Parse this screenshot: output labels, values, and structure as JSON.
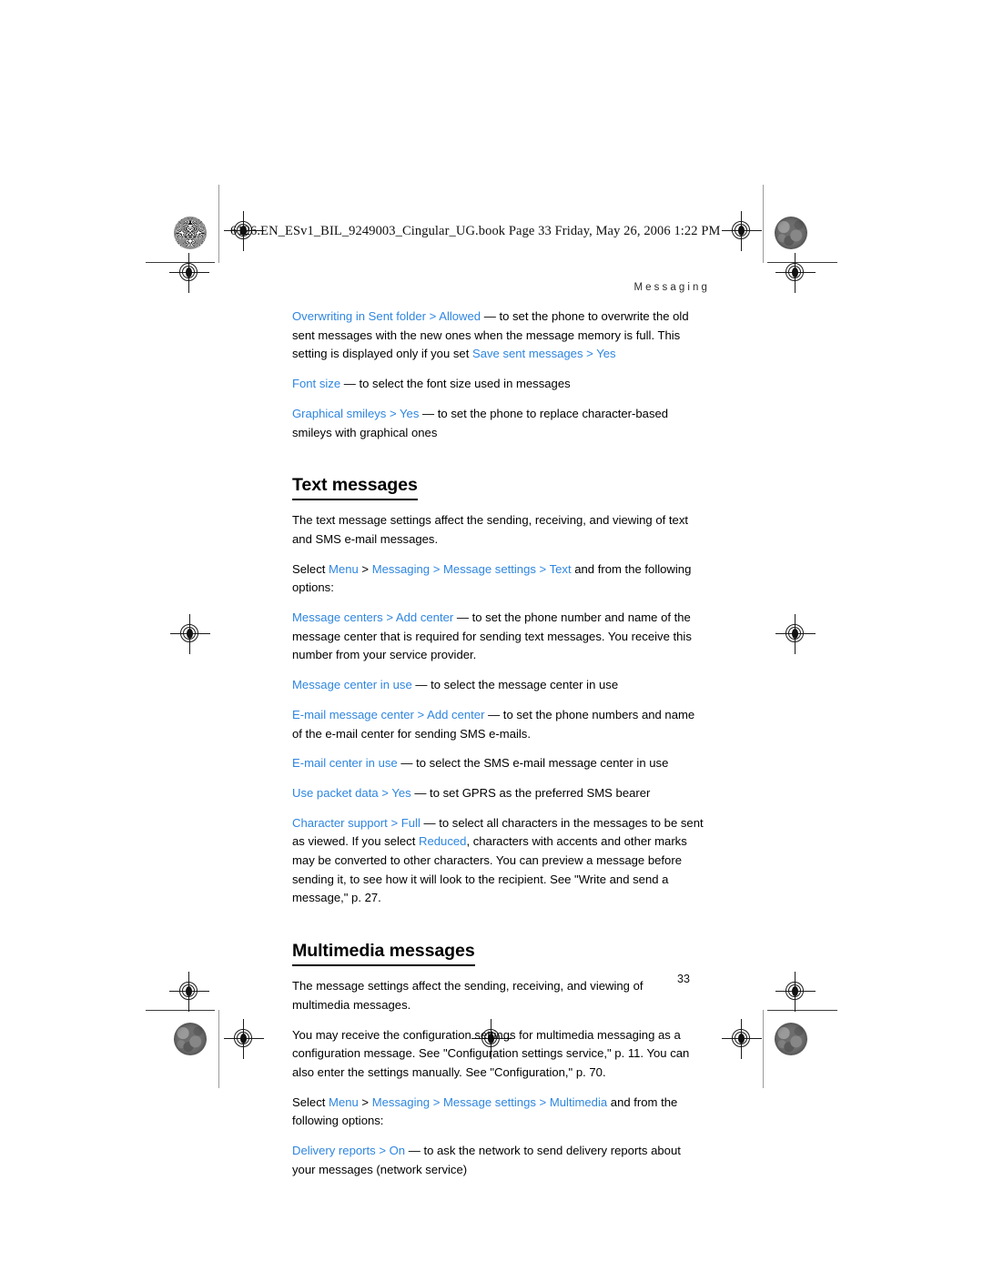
{
  "page": {
    "book_line": "6126.EN_ESv1_BIL_9249003_Cingular_UG.book  Page 33  Friday, May 26, 2006  1:22 PM",
    "running_head": "Messaging",
    "folio": "33",
    "accent_blue": "#2f86e0",
    "text_color": "#000000"
  },
  "content": {
    "blocks": [
      {
        "id": "overwriting",
        "term": "Overwriting in Sent folder",
        "sep": " > ",
        "value": "Allowed",
        "body": " — to set the phone to overwrite the old sent messages with the new ones when the message memory is full. This setting is displayed only if you set ",
        "tail_term": "Save sent messages",
        "tail_sep": " > ",
        "tail_value": "Yes"
      },
      {
        "id": "font-size",
        "term": "Font size",
        "body": " — to select the font size used in messages"
      },
      {
        "id": "graphical-smileys",
        "term": "Graphical smileys",
        "sep": " > ",
        "value": "Yes",
        "body": " — to set the phone to replace character-based smileys with graphical ones"
      }
    ],
    "text_messages": {
      "heading": "Text messages",
      "intro": "The text message settings affect the sending, receiving, and viewing of text and SMS e-mail messages.",
      "select_prefix": "Select ",
      "select_path": [
        "Menu",
        "Messaging",
        "Message settings",
        "Text"
      ],
      "select_suffix": " and from the following options:",
      "options": [
        {
          "id": "message-centers",
          "term": "Message centers",
          "sep": " > ",
          "value": "Add center",
          "body": " — to set the phone number and name of the message center that is required for sending text messages. You receive this number from your service provider."
        },
        {
          "id": "message-center-in-use",
          "term": "Message center in use",
          "body": " — to select the message center in use"
        },
        {
          "id": "email-message-center",
          "term": "E-mail message center",
          "sep": " > ",
          "value": "Add center",
          "body": " — to set the phone numbers and name of the e-mail center for sending SMS e-mails."
        },
        {
          "id": "email-center-in-use",
          "term": "E-mail center in use",
          "body": " — to select the SMS e-mail message center in use"
        },
        {
          "id": "use-packet-data",
          "term": "Use packet data",
          "sep": " > ",
          "value": "Yes",
          "body": " — to set GPRS as the preferred SMS bearer"
        },
        {
          "id": "character-support",
          "term": "Character support",
          "sep": " > ",
          "value": "Full",
          "body": " — to select all characters in the messages to be sent as viewed. If you select ",
          "mid_term": "Reduced",
          "body2": ", characters with accents and other marks may be converted to other characters. You can preview a message before sending it, to see how it will look to the recipient. See \"Write and send a message,\" p. 27."
        }
      ]
    },
    "multimedia_messages": {
      "heading": "Multimedia messages",
      "intro": "The message settings affect the sending, receiving, and viewing of multimedia messages.",
      "config_note": "You may receive the configuration settings for multimedia messaging as a configuration message. See \"Configuration settings service,\" p. 11. You can also enter the settings manually. See \"Configuration,\" p. 70.",
      "select_prefix": "Select ",
      "select_path": [
        "Menu",
        "Messaging",
        "Message settings",
        "Multimedia"
      ],
      "select_suffix": " and from the following options:",
      "options": [
        {
          "id": "delivery-reports",
          "term": "Delivery reports",
          "sep": " > ",
          "value": "On",
          "body": " — to ask the network to send delivery reports about your messages (network service)"
        }
      ]
    }
  }
}
